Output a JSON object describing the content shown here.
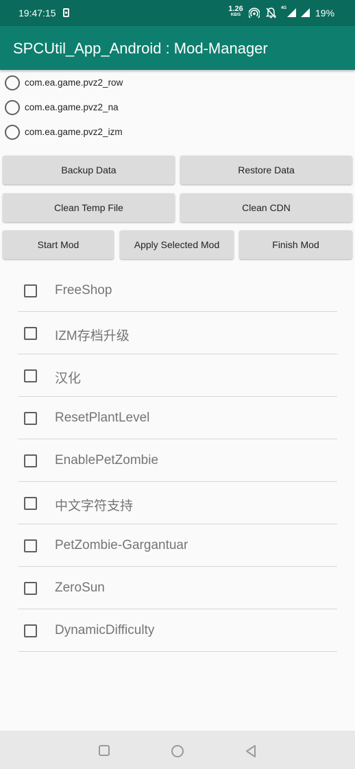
{
  "status_bar": {
    "time": "19:47:15",
    "net_speed": "1.26",
    "net_unit": "KB/S",
    "network_type": "4G",
    "battery": "19%",
    "icons": [
      "phone-icon",
      "hotspot-icon",
      "bell-off-icon",
      "signal-icon",
      "signal-icon",
      "battery-percent"
    ]
  },
  "app_bar": {
    "title": "SPCUtil_App_Android : Mod-Manager",
    "color": "#0e7f6e"
  },
  "packages": [
    {
      "label": "com.ea.game.pvz2_row",
      "selected": false
    },
    {
      "label": "com.ea.game.pvz2_na",
      "selected": false
    },
    {
      "label": "com.ea.game.pvz2_izm",
      "selected": false
    }
  ],
  "buttons": {
    "backup": "Backup Data",
    "restore": "Restore Data",
    "clean_temp": "Clean Temp File",
    "clean_cdn": "Clean CDN",
    "start_mod": "Start Mod",
    "apply_mod": "Apply Selected Mod",
    "finish_mod": "Finish Mod"
  },
  "mods": [
    {
      "label": "FreeShop",
      "checked": false
    },
    {
      "label": "IZM存档升级",
      "checked": false
    },
    {
      "label": "汉化",
      "checked": false
    },
    {
      "label": "ResetPlantLevel",
      "checked": false
    },
    {
      "label": "EnablePetZombie",
      "checked": false
    },
    {
      "label": "中文字符支持",
      "checked": false
    },
    {
      "label": "PetZombie-Gargantuar",
      "checked": false
    },
    {
      "label": "ZeroSun",
      "checked": false
    },
    {
      "label": "DynamicDifficulty",
      "checked": false
    }
  ],
  "nav_bar": {
    "icons": [
      "recents-square-icon",
      "home-circle-icon",
      "back-triangle-icon"
    ]
  }
}
